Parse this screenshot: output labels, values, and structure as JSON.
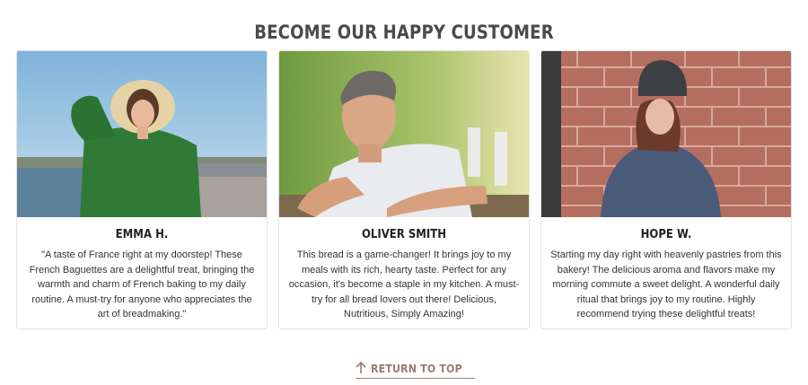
{
  "section": {
    "title": "BECOME OUR HAPPY CUSTOMER"
  },
  "testimonials": [
    {
      "name": "EMMA H.",
      "quote": "\"A taste of France right at my doorstep! These French Baguettes are a delightful treat, bringing the warmth and charm of French baking to my daily routine. A must-try for anyone who appreciates the art of breadmaking.\"",
      "photo_icon": "customer-photo-woman-hat"
    },
    {
      "name": "OLIVER SMITH",
      "quote": "This bread is a game-changer! It brings joy to my meals with its rich, hearty taste. Perfect for any occasion, it's become a staple in my kitchen. A must-try for all bread lovers out there! Delicious, Nutritious, Simply Amazing!",
      "photo_icon": "customer-photo-man-smiling"
    },
    {
      "name": "HOPE W.",
      "quote": "Starting my day right with heavenly pastries from this bakery! The delicious aroma and flavors make my morning commute a sweet delight. A wonderful daily ritual that brings joy to my routine. Highly recommend trying these delightful treats!",
      "photo_icon": "customer-photo-woman-beanie"
    }
  ],
  "footer": {
    "return_top_label": "RETURN TO TOP",
    "return_top_icon": "arrow-up-icon"
  },
  "colors": {
    "accent": "#9b7b6e",
    "title": "#4a4a4a",
    "card_border": "#e3e3e3"
  }
}
